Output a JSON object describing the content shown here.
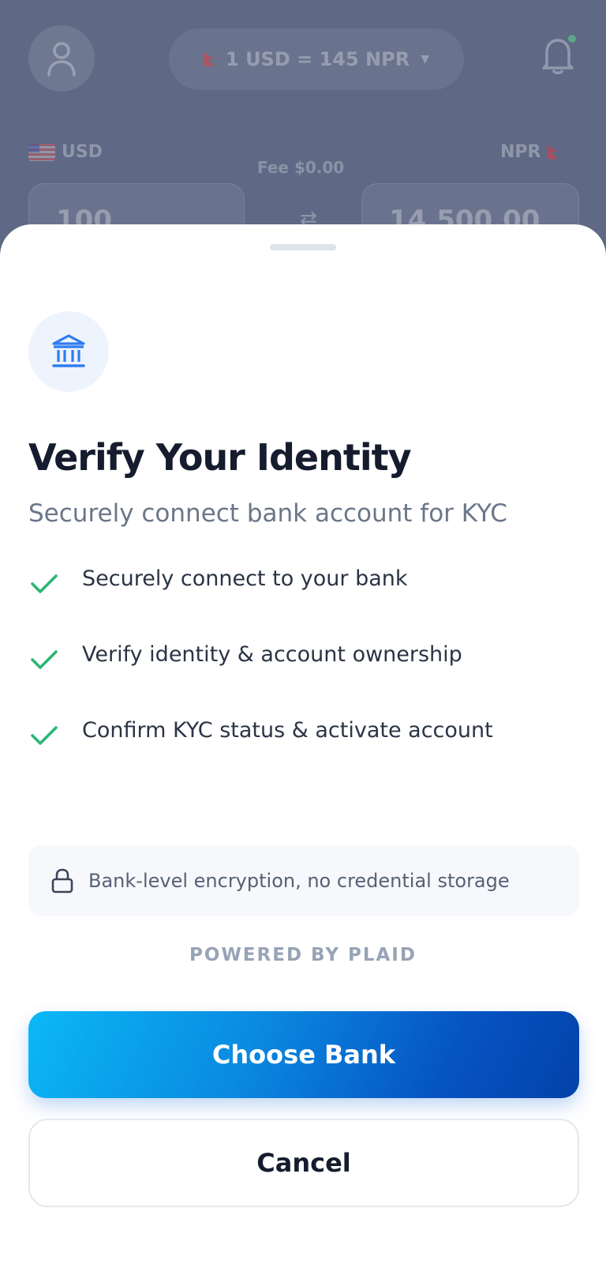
{
  "background": {
    "rate_label": "1 USD = 145 NPR",
    "from_currency": "USD",
    "to_currency": "NPR",
    "fee_label": "Fee $0.00",
    "from_amount": "100",
    "to_amount": "14,500.00"
  },
  "sheet": {
    "title": "Verify Your Identity",
    "subtitle": "Securely connect bank account for KYC",
    "checklist": [
      {
        "label": "Securely connect to your bank"
      },
      {
        "label": "Verify identity & account ownership"
      },
      {
        "label": "Confirm KYC status & activate account"
      }
    ],
    "security_note": "Bank-level encryption, no credential storage",
    "powered_by": "POWERED BY PLAID",
    "primary_button": "Choose Bank",
    "secondary_button": "Cancel"
  },
  "icons": {
    "bank": "bank-icon",
    "check": "check-icon",
    "lock": "lock-icon",
    "user": "user-icon",
    "bell": "bell-icon"
  },
  "colors": {
    "accent_start": "#0bb8f6",
    "accent_end": "#0342a8",
    "check_green": "#2bb673",
    "title": "#151c2e",
    "subtitle": "#6b7689",
    "overlay": "#5f6985"
  }
}
